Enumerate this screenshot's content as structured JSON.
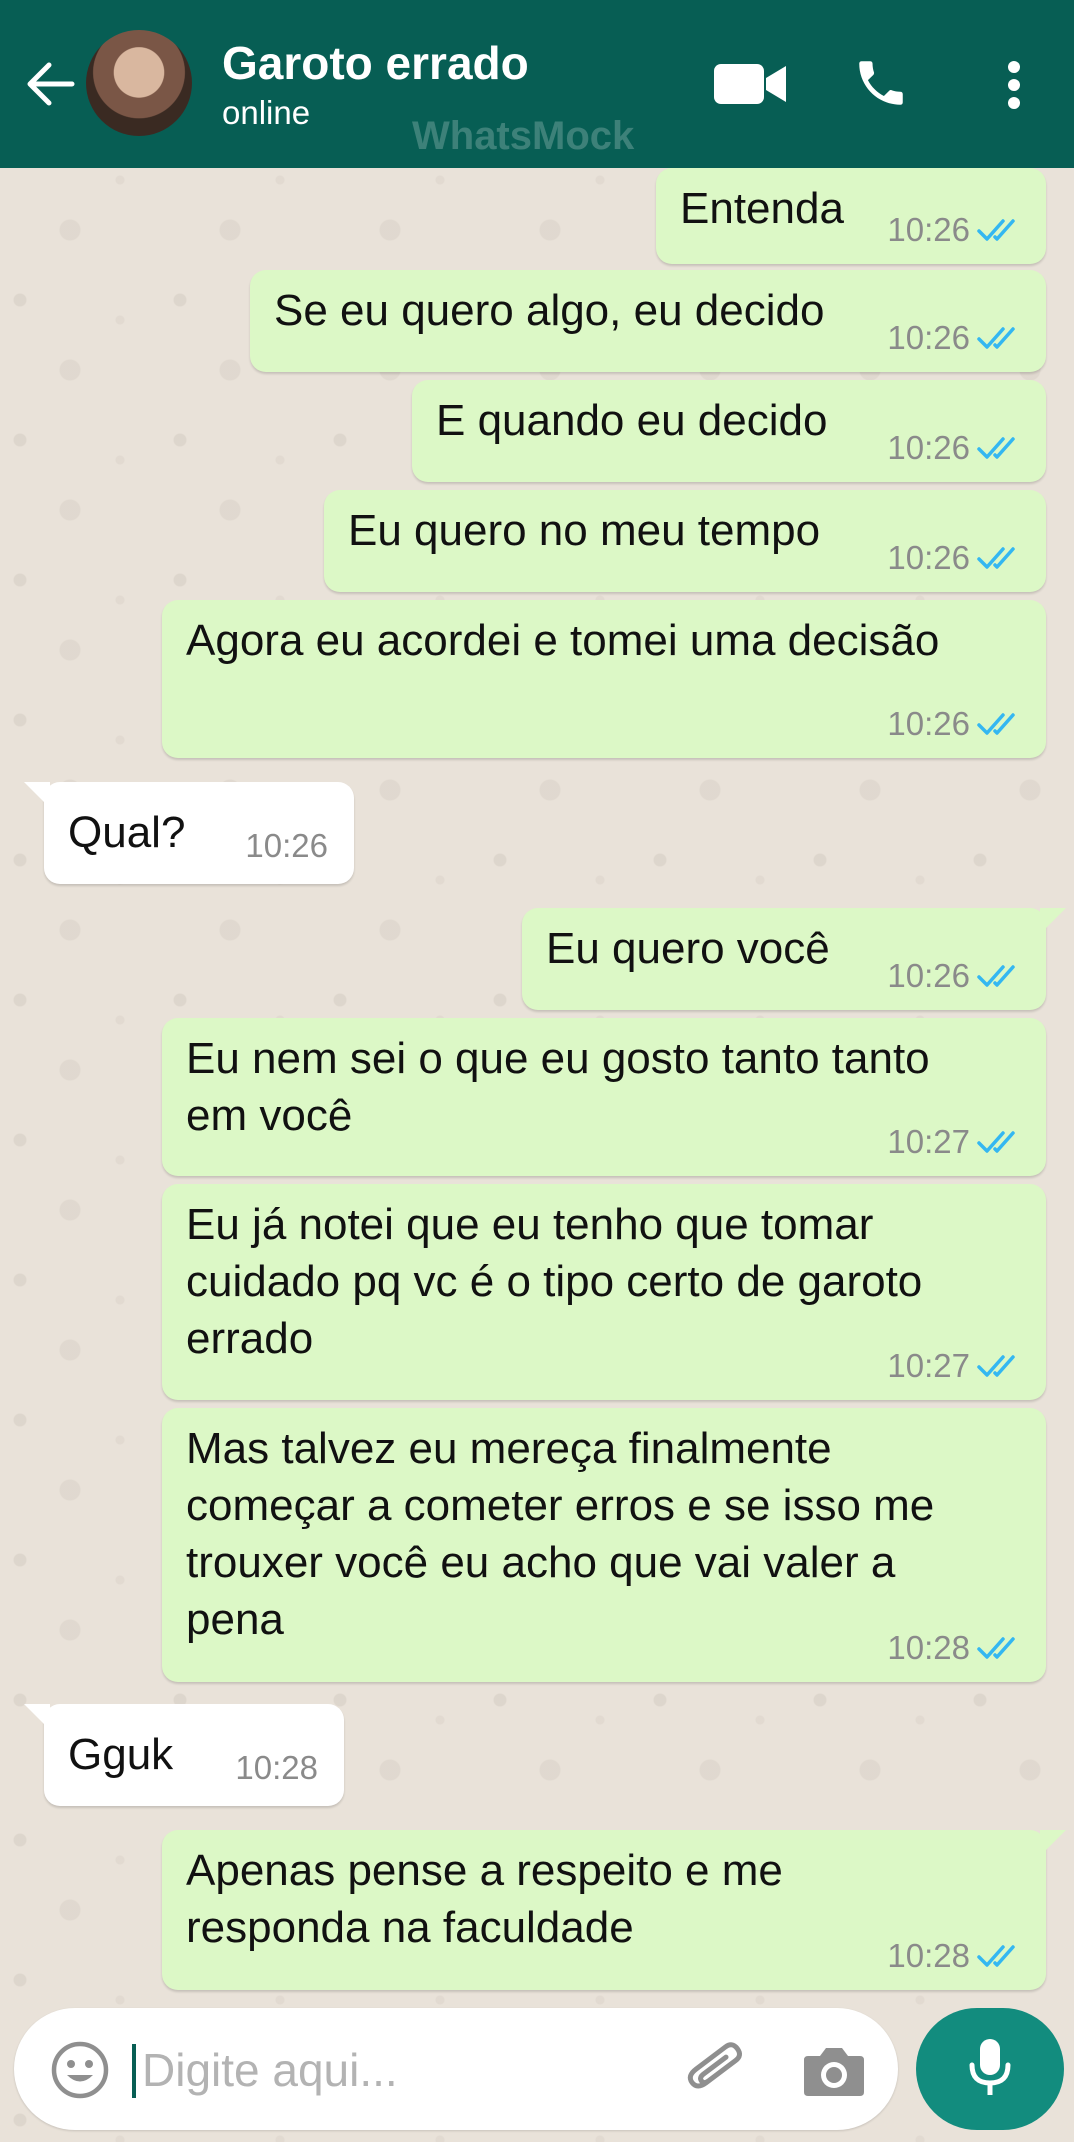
{
  "header": {
    "contact_name": "Garoto errado",
    "status": "online",
    "watermark": "WhatsMock"
  },
  "messages": [
    {
      "direction": "out",
      "text": "Entenda",
      "time": "10:26",
      "status": "read"
    },
    {
      "direction": "out",
      "text": "Se eu quero algo, eu decido",
      "time": "10:26",
      "status": "read"
    },
    {
      "direction": "out",
      "text": "E quando eu decido",
      "time": "10:26",
      "status": "read"
    },
    {
      "direction": "out",
      "text": "Eu quero no meu tempo",
      "time": "10:26",
      "status": "read"
    },
    {
      "direction": "out",
      "text": "Agora eu acordei e tomei uma decisão",
      "time": "10:26",
      "status": "read"
    },
    {
      "direction": "in",
      "text": "Qual?",
      "time": "10:26"
    },
    {
      "direction": "out",
      "text": "Eu quero você",
      "time": "10:26",
      "status": "read"
    },
    {
      "direction": "out",
      "text": "Eu nem sei o que eu gosto tanto tanto\nem você",
      "time": "10:27",
      "status": "read"
    },
    {
      "direction": "out",
      "text": "Eu já notei que eu tenho que tomar\ncuidado pq vc é o tipo certo de garoto\nerrado",
      "time": "10:27",
      "status": "read"
    },
    {
      "direction": "out",
      "text": "Mas talvez eu mereça finalmente\ncomeçar a cometer erros e se isso me\ntrouxer você eu acho que vai valer a\npena",
      "time": "10:28",
      "status": "read"
    },
    {
      "direction": "in",
      "text": "Gguk",
      "time": "10:28"
    },
    {
      "direction": "out",
      "text": "Apenas pense a respeito e me\nresponda na faculdade",
      "time": "10:28",
      "status": "read"
    }
  ],
  "input": {
    "placeholder": "Digite aqui...",
    "value": ""
  },
  "icons": {
    "back": "arrow-left-icon",
    "video": "video-call-icon",
    "call": "phone-icon",
    "menu": "more-vert-icon",
    "emoji": "emoji-icon",
    "attach": "paperclip-icon",
    "camera": "camera-icon",
    "mic": "mic-icon",
    "read": "double-check-icon"
  },
  "colors": {
    "header": "#075E54",
    "outgoing_bubble": "#DCF8C6",
    "incoming_bubble": "#FFFFFF",
    "read_ticks": "#34B7F1",
    "mic_button": "#128C7E",
    "chat_background": "#ECE5DD"
  }
}
